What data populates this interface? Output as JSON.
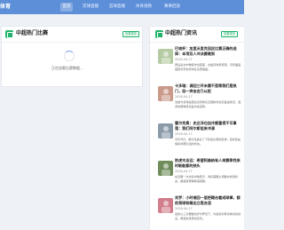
{
  "header": {
    "logo": "体育",
    "nav": [
      "首页",
      "足球直播",
      "篮球直播",
      "体育视频",
      "赛事回放"
    ]
  },
  "left_panel": {
    "title": "中超热门比赛",
    "more_label": "查看更多",
    "loading_text": "正在加载比赛数据..."
  },
  "right_panel": {
    "title": "中超热门资讯",
    "more_label": "查看更多",
    "news": [
      {
        "title": "巴坡杯：加里沃里克回应比赛正确的选择：本项双人冲决赛晚到",
        "date": "2026-04-17",
        "summary": "赛后采访中教练作出回答，在板间球员表现，尽管面临强势对手依然作好比赛准备。",
        "color": "#b5cba3"
      },
      {
        "title": "卡多瑞：调回三环未赛不是等我们是热门，但一突击会乃以赶",
        "date": "2026-04-17",
        "summary": "当前卡多瑞在赛后谈到球队近期的状态及备战情况，强调本赛季目标是冲击冠军。",
        "color": "#c99a8a"
      },
      {
        "title": "塞尔克奥：史达洋也加冷都重视不可事落：我们阿尔斯组来冲演",
        "date": "2026-04-17",
        "summary": "4月16日，塞尔克奥谈了下阶段比赛的安排，目标就是保持冲赛队伍的状态。",
        "color": "#8a9aa8"
      },
      {
        "title": "豹虎木志远：希望阿森纳有人来赛季找来时新能都的抉头",
        "date": "2026-04-17",
        "summary": "在近期一次访谈中他表示，球队需要从调整中找到状态，寄望新赛季取得突破。",
        "color": "#6f8c5a"
      },
      {
        "title": "肖罗：小时候回一层把踢击着成球棒，都依我球和踢出立是合适",
        "date": "2026-04-17",
        "summary": "最新以三次要数和乔尔罗克下，均提到对青训体系的建设，希望未来更加完善。",
        "color": "#d17d8c"
      }
    ]
  }
}
